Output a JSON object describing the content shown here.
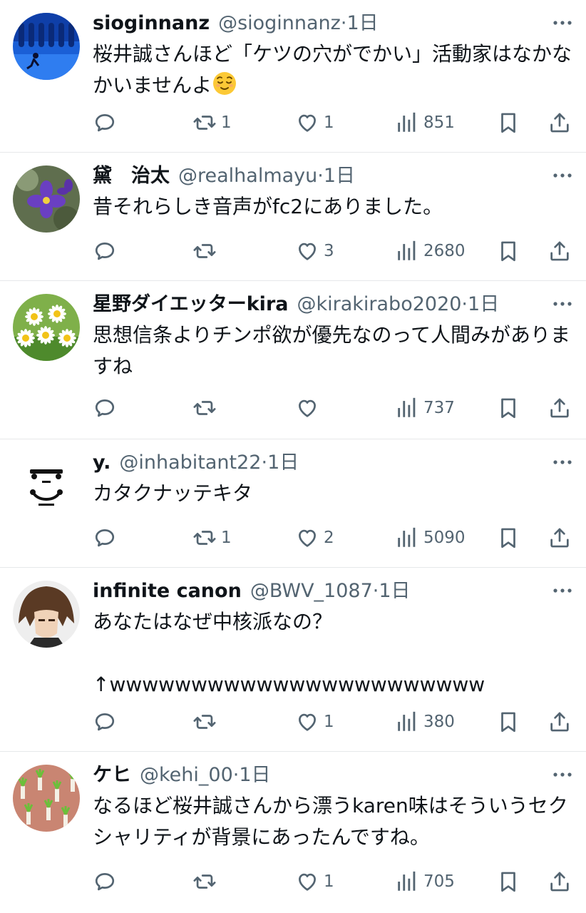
{
  "tweets": [
    {
      "name": "sioginnanz",
      "handle": "@sioginnanz",
      "time": "1日",
      "text": "桜井誠さんほど「ケツの穴がでかい」活動家はなかなかいませんよ",
      "emoji": "relieved-face",
      "replies": "",
      "retweets": "1",
      "likes": "1",
      "views": "851",
      "avatar": "tunnel-runner"
    },
    {
      "name": "黛　治太",
      "handle": "@realhalmayu",
      "time": "1日",
      "text": "昔それらしき音声がfc2にありました。",
      "replies": "",
      "retweets": "",
      "likes": "3",
      "views": "2680",
      "avatar": "purple-flower"
    },
    {
      "name": "星野ダイエッターkira",
      "handle": "@kirakirabo2020",
      "time": "1日",
      "text": "思想信条よりチンポ欲が優先なのって人間みがありますね",
      "replies": "",
      "retweets": "",
      "likes": "",
      "views": "737",
      "avatar": "daisies"
    },
    {
      "name": "y.",
      "handle": "@inhabitant22",
      "time": "1日",
      "text": "カタクナッテキタ",
      "replies": "",
      "retweets": "1",
      "likes": "2",
      "views": "5090",
      "avatar": "friends-logo"
    },
    {
      "name": "infinite canon",
      "handle": "@BWV_1087",
      "time": "1日",
      "text": "あなたはなぜ中核派なの？\n\n↑wwwwwwwwwwwwwwwwwwwwwww",
      "replies": "",
      "retweets": "",
      "likes": "1",
      "views": "380",
      "avatar": "anime-character"
    },
    {
      "name": "ケヒ",
      "handle": "@kehi_00",
      "time": "1日",
      "text": "なるほど桜井誠さんから漂うkaren味はそういうセクシャリティが背景にあったんですね。",
      "replies": "",
      "retweets": "",
      "likes": "1",
      "views": "705",
      "avatar": "scallions"
    }
  ],
  "separator": "·",
  "colors": {
    "text": "#0f1419",
    "secondary": "#536471",
    "divider": "#e6e8ea"
  },
  "icons": {
    "reply": "reply-icon",
    "retweet": "retweet-icon",
    "like": "heart-icon",
    "views": "views-icon",
    "bookmark": "bookmark-icon",
    "share": "share-icon",
    "more": "more-icon"
  }
}
